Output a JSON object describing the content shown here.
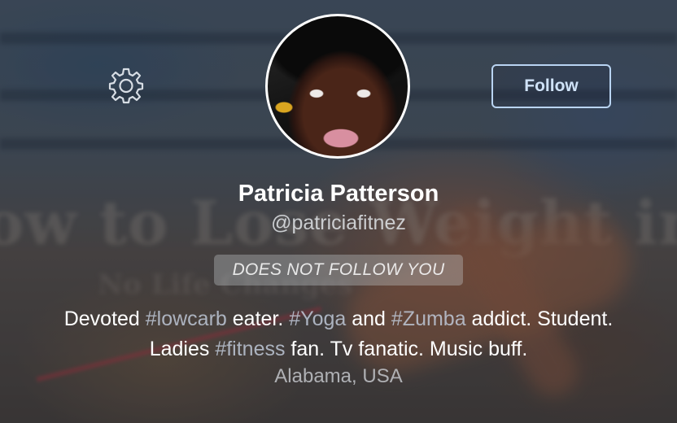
{
  "profile": {
    "name": "Patricia Patterson",
    "handle": "@patriciafitnez",
    "relationship_badge": "DOES NOT FOLLOW YOU",
    "bio_line1": [
      {
        "text": "Devoted ",
        "tag": false
      },
      {
        "text": "#lowcarb",
        "tag": true
      },
      {
        "text": " eater. ",
        "tag": false
      },
      {
        "text": "#Yoga",
        "tag": true
      },
      {
        "text": " and ",
        "tag": false
      },
      {
        "text": "#Zumba",
        "tag": true
      },
      {
        "text": " addict. Student.",
        "tag": false
      }
    ],
    "bio_line2": [
      {
        "text": "Ladies ",
        "tag": false
      },
      {
        "text": "#fitness",
        "tag": true
      },
      {
        "text": " fan. Tv fanatic. Music buff.",
        "tag": false
      }
    ],
    "location": "Alabama, USA"
  },
  "actions": {
    "follow_label": "Follow"
  },
  "icons": {
    "settings": "gear-icon"
  },
  "colors": {
    "follow_border": "#b9d4f2",
    "hashtag": "#bec8d7"
  }
}
